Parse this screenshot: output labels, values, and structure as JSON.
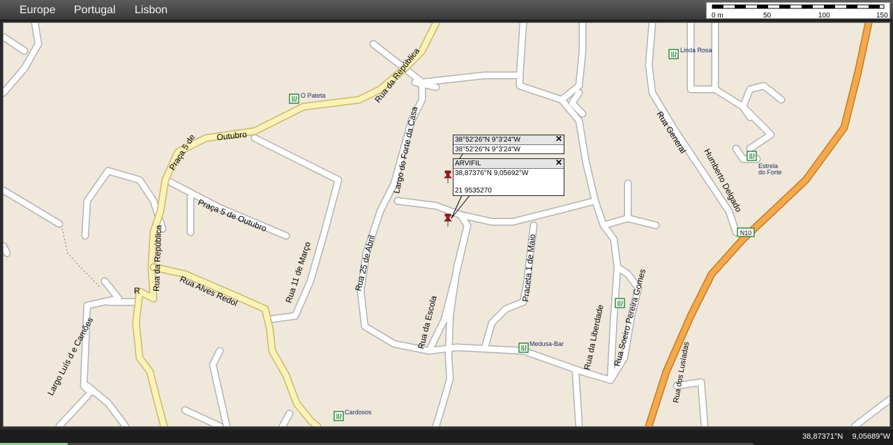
{
  "breadcrumbs": [
    "Europe",
    "Portugal",
    "Lisbon"
  ],
  "scale": {
    "labels": [
      "0 m",
      "50",
      "100",
      "150"
    ]
  },
  "status": {
    "latitude": "38,87371°N",
    "longitude": "9,05689°W",
    "progress": 0.09
  },
  "popups": {
    "coords": {
      "title": "38°52'26\"N 9°3'24\"W",
      "line1": "38°52'26\"N 9°3'24\"W"
    },
    "business": {
      "title": "ARVIFIL",
      "line1": "38,87376°N 9,05692°W",
      "line2": "21 9535270"
    },
    "close_glyph": "✕"
  },
  "streets": {
    "rua_da_republica_top": "Rua da República",
    "praca_5_outubro_a": "Praça 5 de",
    "outubro": "Outubro",
    "praca_5_outubro_b": "Praça 5 de Outubro",
    "rua_da_republica_left": "Rua da República",
    "rua_alves_redol": "Rua Alves Redol",
    "rua_11_marco": "Rua 11 de Março",
    "largo_forte_casa": "Largo do Forte da Casa",
    "rua_25_abril": "Rua 25 de Abril",
    "rua_da_escola": "Rua da Escola",
    "praceta_1_maio": "Praceta 1 de Maio",
    "rua_liberdade": "Rua da Liberdade",
    "rua_soeiro": "Rua Soeiro Pereira Gomes",
    "rua_general": "Rua General",
    "humberto": "Humberto Delgado",
    "largo_luis": "Largo Luís d e Camões",
    "rua_lusiadas": "Rua dos Lusíadas",
    "r_letter": "R"
  },
  "road_badge": "N10",
  "pois": {
    "o_pateta": "O Pateta",
    "linda_rosa": "Linda Rosa",
    "estrela_1": "Estrela",
    "estrela_2": "do Forte",
    "medusa_bar": "Medusa-Bar",
    "cardosos": "Cardosos"
  },
  "colors": {
    "map_bg": "#f0e8da",
    "road": "#ffffff",
    "road_edge": "#b0b0b0",
    "main_road": "#fbf2b8",
    "highway": "#f4a94c",
    "poi_icon": "#2e8b3c"
  }
}
